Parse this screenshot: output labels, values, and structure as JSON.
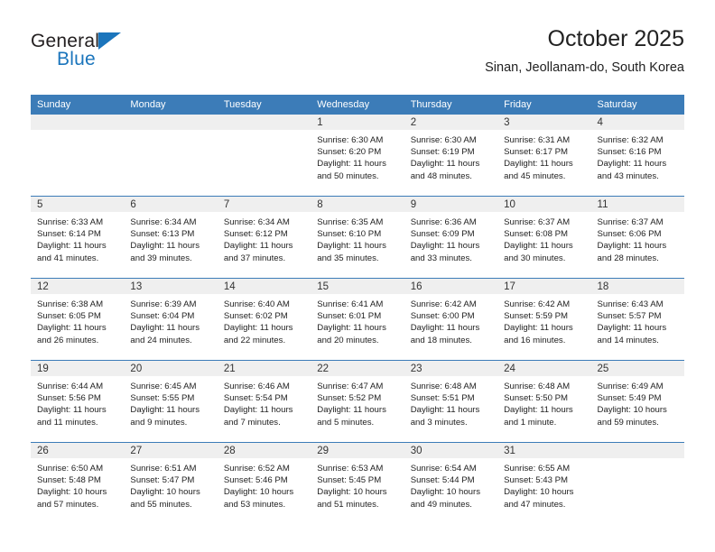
{
  "brand": {
    "name_top": "General",
    "name_bottom": "Blue",
    "accent_color": "#1b75bc"
  },
  "header": {
    "title": "October 2025",
    "subtitle": "Sinan, Jeollanam-do, South Korea"
  },
  "theme": {
    "header_row_bg": "#3c7cb8",
    "daynum_bg": "#efefef",
    "grid_line": "#3c7cb8"
  },
  "weekday_headers": [
    "Sunday",
    "Monday",
    "Tuesday",
    "Wednesday",
    "Thursday",
    "Friday",
    "Saturday"
  ],
  "labels": {
    "sunrise_prefix": "Sunrise: ",
    "sunset_prefix": "Sunset: ",
    "daylight_prefix": "Daylight: "
  },
  "weeks": [
    [
      {
        "day": "",
        "sunrise": "",
        "sunset": "",
        "daylight": "",
        "empty": true
      },
      {
        "day": "",
        "sunrise": "",
        "sunset": "",
        "daylight": "",
        "empty": true
      },
      {
        "day": "",
        "sunrise": "",
        "sunset": "",
        "daylight": "",
        "empty": true
      },
      {
        "day": "1",
        "sunrise": "Sunrise: 6:30 AM",
        "sunset": "Sunset: 6:20 PM",
        "daylight": "Daylight: 11 hours and 50 minutes."
      },
      {
        "day": "2",
        "sunrise": "Sunrise: 6:30 AM",
        "sunset": "Sunset: 6:19 PM",
        "daylight": "Daylight: 11 hours and 48 minutes."
      },
      {
        "day": "3",
        "sunrise": "Sunrise: 6:31 AM",
        "sunset": "Sunset: 6:17 PM",
        "daylight": "Daylight: 11 hours and 45 minutes."
      },
      {
        "day": "4",
        "sunrise": "Sunrise: 6:32 AM",
        "sunset": "Sunset: 6:16 PM",
        "daylight": "Daylight: 11 hours and 43 minutes."
      }
    ],
    [
      {
        "day": "5",
        "sunrise": "Sunrise: 6:33 AM",
        "sunset": "Sunset: 6:14 PM",
        "daylight": "Daylight: 11 hours and 41 minutes."
      },
      {
        "day": "6",
        "sunrise": "Sunrise: 6:34 AM",
        "sunset": "Sunset: 6:13 PM",
        "daylight": "Daylight: 11 hours and 39 minutes."
      },
      {
        "day": "7",
        "sunrise": "Sunrise: 6:34 AM",
        "sunset": "Sunset: 6:12 PM",
        "daylight": "Daylight: 11 hours and 37 minutes."
      },
      {
        "day": "8",
        "sunrise": "Sunrise: 6:35 AM",
        "sunset": "Sunset: 6:10 PM",
        "daylight": "Daylight: 11 hours and 35 minutes."
      },
      {
        "day": "9",
        "sunrise": "Sunrise: 6:36 AM",
        "sunset": "Sunset: 6:09 PM",
        "daylight": "Daylight: 11 hours and 33 minutes."
      },
      {
        "day": "10",
        "sunrise": "Sunrise: 6:37 AM",
        "sunset": "Sunset: 6:08 PM",
        "daylight": "Daylight: 11 hours and 30 minutes."
      },
      {
        "day": "11",
        "sunrise": "Sunrise: 6:37 AM",
        "sunset": "Sunset: 6:06 PM",
        "daylight": "Daylight: 11 hours and 28 minutes."
      }
    ],
    [
      {
        "day": "12",
        "sunrise": "Sunrise: 6:38 AM",
        "sunset": "Sunset: 6:05 PM",
        "daylight": "Daylight: 11 hours and 26 minutes."
      },
      {
        "day": "13",
        "sunrise": "Sunrise: 6:39 AM",
        "sunset": "Sunset: 6:04 PM",
        "daylight": "Daylight: 11 hours and 24 minutes."
      },
      {
        "day": "14",
        "sunrise": "Sunrise: 6:40 AM",
        "sunset": "Sunset: 6:02 PM",
        "daylight": "Daylight: 11 hours and 22 minutes."
      },
      {
        "day": "15",
        "sunrise": "Sunrise: 6:41 AM",
        "sunset": "Sunset: 6:01 PM",
        "daylight": "Daylight: 11 hours and 20 minutes."
      },
      {
        "day": "16",
        "sunrise": "Sunrise: 6:42 AM",
        "sunset": "Sunset: 6:00 PM",
        "daylight": "Daylight: 11 hours and 18 minutes."
      },
      {
        "day": "17",
        "sunrise": "Sunrise: 6:42 AM",
        "sunset": "Sunset: 5:59 PM",
        "daylight": "Daylight: 11 hours and 16 minutes."
      },
      {
        "day": "18",
        "sunrise": "Sunrise: 6:43 AM",
        "sunset": "Sunset: 5:57 PM",
        "daylight": "Daylight: 11 hours and 14 minutes."
      }
    ],
    [
      {
        "day": "19",
        "sunrise": "Sunrise: 6:44 AM",
        "sunset": "Sunset: 5:56 PM",
        "daylight": "Daylight: 11 hours and 11 minutes."
      },
      {
        "day": "20",
        "sunrise": "Sunrise: 6:45 AM",
        "sunset": "Sunset: 5:55 PM",
        "daylight": "Daylight: 11 hours and 9 minutes."
      },
      {
        "day": "21",
        "sunrise": "Sunrise: 6:46 AM",
        "sunset": "Sunset: 5:54 PM",
        "daylight": "Daylight: 11 hours and 7 minutes."
      },
      {
        "day": "22",
        "sunrise": "Sunrise: 6:47 AM",
        "sunset": "Sunset: 5:52 PM",
        "daylight": "Daylight: 11 hours and 5 minutes."
      },
      {
        "day": "23",
        "sunrise": "Sunrise: 6:48 AM",
        "sunset": "Sunset: 5:51 PM",
        "daylight": "Daylight: 11 hours and 3 minutes."
      },
      {
        "day": "24",
        "sunrise": "Sunrise: 6:48 AM",
        "sunset": "Sunset: 5:50 PM",
        "daylight": "Daylight: 11 hours and 1 minute."
      },
      {
        "day": "25",
        "sunrise": "Sunrise: 6:49 AM",
        "sunset": "Sunset: 5:49 PM",
        "daylight": "Daylight: 10 hours and 59 minutes."
      }
    ],
    [
      {
        "day": "26",
        "sunrise": "Sunrise: 6:50 AM",
        "sunset": "Sunset: 5:48 PM",
        "daylight": "Daylight: 10 hours and 57 minutes."
      },
      {
        "day": "27",
        "sunrise": "Sunrise: 6:51 AM",
        "sunset": "Sunset: 5:47 PM",
        "daylight": "Daylight: 10 hours and 55 minutes."
      },
      {
        "day": "28",
        "sunrise": "Sunrise: 6:52 AM",
        "sunset": "Sunset: 5:46 PM",
        "daylight": "Daylight: 10 hours and 53 minutes."
      },
      {
        "day": "29",
        "sunrise": "Sunrise: 6:53 AM",
        "sunset": "Sunset: 5:45 PM",
        "daylight": "Daylight: 10 hours and 51 minutes."
      },
      {
        "day": "30",
        "sunrise": "Sunrise: 6:54 AM",
        "sunset": "Sunset: 5:44 PM",
        "daylight": "Daylight: 10 hours and 49 minutes."
      },
      {
        "day": "31",
        "sunrise": "Sunrise: 6:55 AM",
        "sunset": "Sunset: 5:43 PM",
        "daylight": "Daylight: 10 hours and 47 minutes."
      },
      {
        "day": "",
        "sunrise": "",
        "sunset": "",
        "daylight": "",
        "empty": true
      }
    ]
  ]
}
